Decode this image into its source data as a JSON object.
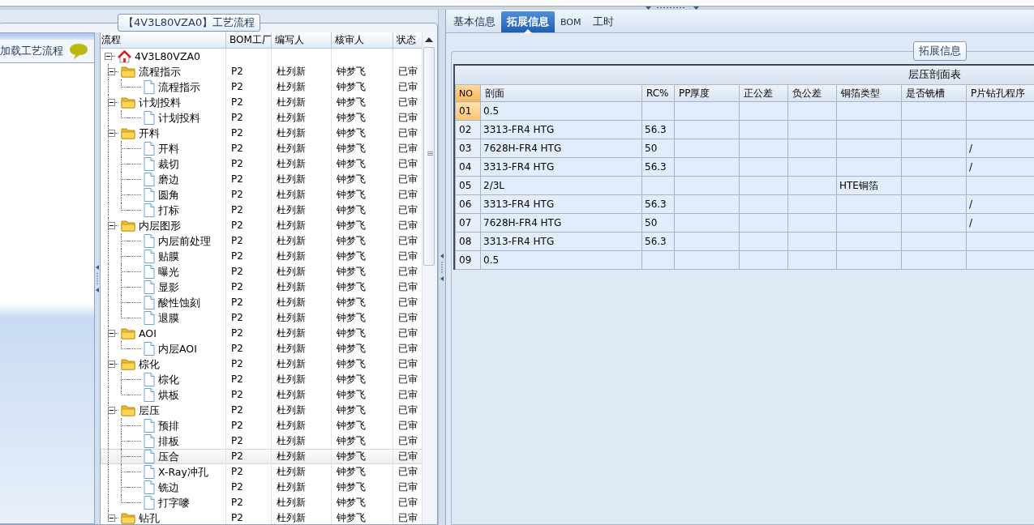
{
  "left_nav": {
    "items": [
      {
        "label": "加载工艺流程"
      }
    ]
  },
  "process_tree": {
    "title": "【4V3L80VZA0】工艺流程",
    "columns": [
      "流程",
      "BOM工厂",
      "编写人",
      "核审人",
      "状态"
    ],
    "root": {
      "label": "4V3L80VZA0",
      "expanded": true,
      "selected": false,
      "children": [
        {
          "label": "流程指示",
          "expanded": true,
          "selected": false,
          "cells": [
            "P2",
            "杜列新",
            "钟梦飞",
            "已审"
          ],
          "children": [
            {
              "label": "流程指示",
              "selected": false,
              "cells": [
                "P2",
                "杜列新",
                "钟梦飞",
                "已审"
              ]
            }
          ]
        },
        {
          "label": "计划投料",
          "expanded": true,
          "selected": false,
          "cells": [
            "P2",
            "杜列新",
            "钟梦飞",
            "已审"
          ],
          "children": [
            {
              "label": "计划投料",
              "selected": false,
              "cells": [
                "P2",
                "杜列新",
                "钟梦飞",
                "已审"
              ]
            }
          ]
        },
        {
          "label": "开料",
          "expanded": true,
          "selected": false,
          "cells": [
            "P2",
            "杜列新",
            "钟梦飞",
            "已审"
          ],
          "children": [
            {
              "label": "开料",
              "selected": false,
              "cells": [
                "P2",
                "杜列新",
                "钟梦飞",
                "已审"
              ]
            },
            {
              "label": "裁切",
              "selected": false,
              "cells": [
                "P2",
                "杜列新",
                "钟梦飞",
                "已审"
              ]
            },
            {
              "label": "磨边",
              "selected": false,
              "cells": [
                "P2",
                "杜列新",
                "钟梦飞",
                "已审"
              ]
            },
            {
              "label": "圆角",
              "selected": false,
              "cells": [
                "P2",
                "杜列新",
                "钟梦飞",
                "已审"
              ]
            },
            {
              "label": "打标",
              "selected": false,
              "cells": [
                "P2",
                "杜列新",
                "钟梦飞",
                "已审"
              ]
            }
          ]
        },
        {
          "label": "内层图形",
          "expanded": true,
          "selected": false,
          "cells": [
            "P2",
            "杜列新",
            "钟梦飞",
            "已审"
          ],
          "children": [
            {
              "label": "内层前处理",
              "selected": false,
              "cells": [
                "P2",
                "杜列新",
                "钟梦飞",
                "已审"
              ]
            },
            {
              "label": "贴膜",
              "selected": false,
              "cells": [
                "P2",
                "杜列新",
                "钟梦飞",
                "已审"
              ]
            },
            {
              "label": "曝光",
              "selected": false,
              "cells": [
                "P2",
                "杜列新",
                "钟梦飞",
                "已审"
              ]
            },
            {
              "label": "显影",
              "selected": false,
              "cells": [
                "P2",
                "杜列新",
                "钟梦飞",
                "已审"
              ]
            },
            {
              "label": "酸性蚀刻",
              "selected": false,
              "cells": [
                "P2",
                "杜列新",
                "钟梦飞",
                "已审"
              ]
            },
            {
              "label": "退膜",
              "selected": false,
              "cells": [
                "P2",
                "杜列新",
                "钟梦飞",
                "已审"
              ]
            }
          ]
        },
        {
          "label": "AOI",
          "expanded": true,
          "selected": false,
          "cells": [
            "P2",
            "杜列新",
            "钟梦飞",
            "已审"
          ],
          "children": [
            {
              "label": "内层AOI",
              "selected": false,
              "cells": [
                "P2",
                "杜列新",
                "钟梦飞",
                "已审"
              ]
            }
          ]
        },
        {
          "label": "棕化",
          "expanded": true,
          "selected": false,
          "cells": [
            "P2",
            "杜列新",
            "钟梦飞",
            "已审"
          ],
          "children": [
            {
              "label": "棕化",
              "selected": false,
              "cells": [
                "P2",
                "杜列新",
                "钟梦飞",
                "已审"
              ]
            },
            {
              "label": "烘板",
              "selected": false,
              "cells": [
                "P2",
                "杜列新",
                "钟梦飞",
                "已审"
              ]
            }
          ]
        },
        {
          "label": "层压",
          "expanded": true,
          "selected": false,
          "cells": [
            "P2",
            "杜列新",
            "钟梦飞",
            "已审"
          ],
          "children": [
            {
              "label": "预排",
              "selected": false,
              "cells": [
                "P2",
                "杜列新",
                "钟梦飞",
                "已审"
              ]
            },
            {
              "label": "排板",
              "selected": false,
              "cells": [
                "P2",
                "杜列新",
                "钟梦飞",
                "已审"
              ]
            },
            {
              "label": "压合",
              "selected": true,
              "cells": [
                "P2",
                "杜列新",
                "钟梦飞",
                "已审"
              ]
            },
            {
              "label": "X-Ray冲孔",
              "selected": false,
              "cells": [
                "P2",
                "杜列新",
                "钟梦飞",
                "已审"
              ]
            },
            {
              "label": "铣边",
              "selected": false,
              "cells": [
                "P2",
                "杜列新",
                "钟梦飞",
                "已审"
              ]
            },
            {
              "label": "打字嘜",
              "selected": false,
              "cells": [
                "P2",
                "杜列新",
                "钟梦飞",
                "已审"
              ]
            }
          ]
        },
        {
          "label": "钻孔",
          "expanded": true,
          "selected": false,
          "cells": [
            "P2",
            "杜列新",
            "钟梦飞",
            "已审"
          ]
        }
      ]
    }
  },
  "detail": {
    "tabs": [
      {
        "label": "基本信息",
        "selected": false
      },
      {
        "label": "拓展信息",
        "selected": true
      },
      {
        "label": "BOM",
        "selected": false
      },
      {
        "label": "工时",
        "selected": false
      }
    ],
    "group_title": "拓展信息",
    "table": {
      "title": "层压剖面表",
      "columns": [
        "NO",
        "剖面",
        "RC%",
        "PP厚度",
        "正公差",
        "负公差",
        "铜箔类型",
        "是否铣槽",
        "P片钻孔程序"
      ],
      "rows": [
        {
          "no": "01",
          "section": "0.5",
          "selected": true
        },
        {
          "no": "02",
          "section": "3313-FR4 HTG",
          "rc": "56.3",
          "selected": false
        },
        {
          "no": "03",
          "section": "7628H-FR4 HTG",
          "rc": "50",
          "drill": "/",
          "selected": false
        },
        {
          "no": "04",
          "section": "3313-FR4 HTG",
          "rc": "56.3",
          "drill": "/",
          "selected": false
        },
        {
          "no": "05",
          "section": "2/3L",
          "foil": "HTE铜箔",
          "selected": false
        },
        {
          "no": "06",
          "section": "3313-FR4 HTG",
          "rc": "56.3",
          "drill": "/",
          "selected": false
        },
        {
          "no": "07",
          "section": "7628H-FR4 HTG",
          "rc": "50",
          "drill": "/",
          "selected": false
        },
        {
          "no": "08",
          "section": "3313-FR4 HTG",
          "rc": "56.3",
          "selected": false
        },
        {
          "no": "09",
          "section": "0.5",
          "selected": false
        }
      ]
    }
  }
}
